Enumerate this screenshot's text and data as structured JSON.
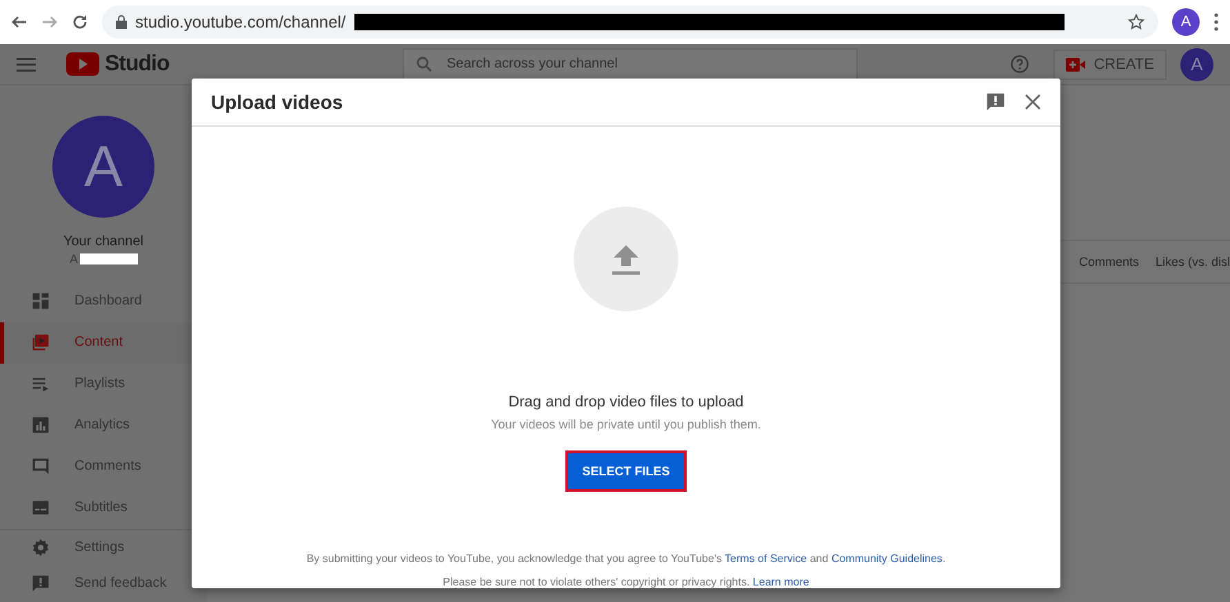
{
  "browser": {
    "url": "studio.youtube.com/channel/",
    "profile_initial": "A"
  },
  "header": {
    "logo_text": "Studio",
    "search": {
      "placeholder": "Search across your channel"
    },
    "create_label": "CREATE",
    "avatar_initial": "A"
  },
  "sidebar": {
    "avatar_initial": "A",
    "channel_label": "Your channel",
    "channel_handle": "A",
    "items": [
      {
        "label": "Dashboard",
        "kind": "dashboard",
        "selected": false
      },
      {
        "label": "Content",
        "kind": "content",
        "selected": true
      },
      {
        "label": "Playlists",
        "kind": "playlists",
        "selected": false
      },
      {
        "label": "Analytics",
        "kind": "analytics",
        "selected": false
      },
      {
        "label": "Comments",
        "kind": "comments",
        "selected": false
      },
      {
        "label": "Subtitles",
        "kind": "subtitles",
        "selected": false
      }
    ],
    "footer_items": [
      {
        "label": "Settings",
        "kind": "settings",
        "selected": false
      },
      {
        "label": "Send feedback",
        "kind": "feedback",
        "selected": false
      }
    ]
  },
  "table": {
    "columns": [
      "Comments",
      "Likes (vs. disl"
    ]
  },
  "dialog": {
    "title": "Upload videos",
    "heading": "Drag and drop video files to upload",
    "subtext": "Your videos will be private until you publish them.",
    "button": "SELECT FILES",
    "legal_prefix": "By submitting your videos to YouTube, you acknowledge that you agree to YouTube's",
    "terms_link": "Terms of Service",
    "legal_and": "and",
    "guidelines_link": "Community Guidelines",
    "legal_suffix": ".",
    "note": "Please be sure not to violate others' copyright or privacy rights.",
    "learn_more": "Learn more"
  }
}
